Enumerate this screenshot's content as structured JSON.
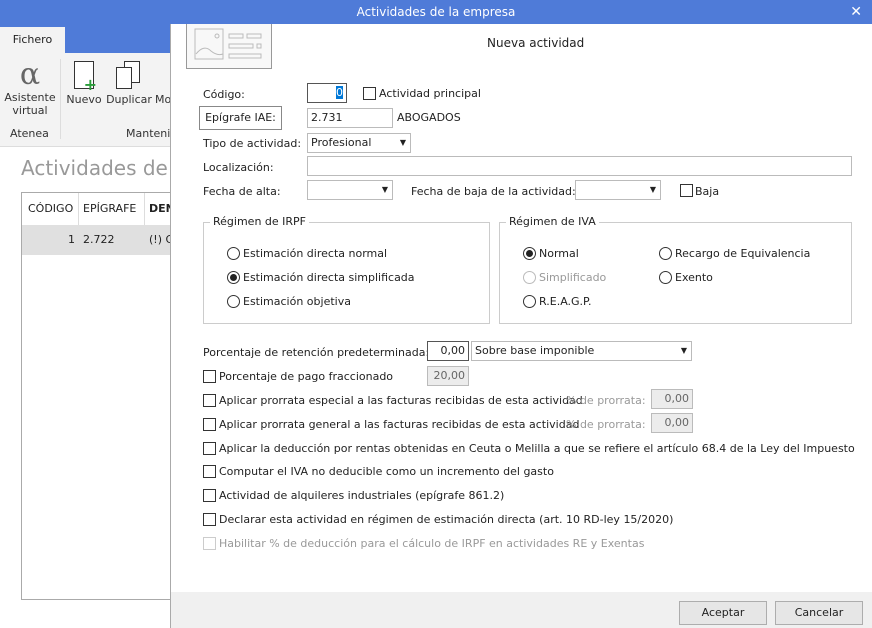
{
  "window": {
    "title": "Actividades de la empresa",
    "close": "✕"
  },
  "ribbon": {
    "tab": "Fichero",
    "assistant_line1": "Asistente",
    "assistant_line2": "virtual",
    "group_atenea": "Atenea",
    "nuevo": "Nuevo",
    "duplicar": "Duplicar",
    "mod": "Mo",
    "group_mant": "Manteni"
  },
  "list": {
    "title": "Actividades de la",
    "columns": [
      "CÓDIGO",
      "EPÍGRAFE",
      "DEN"
    ],
    "row": {
      "codigo": "1",
      "epigrafe": "2.722",
      "den": "(!) G"
    }
  },
  "dialog": {
    "title": "Nueva actividad",
    "codigo_label": "Código:",
    "codigo_value": "0",
    "principal_label": "Actividad principal",
    "epigrafe_button": "Epígrafe IAE:",
    "epigrafe_value": "2.731",
    "epigrafe_desc": "ABOGADOS",
    "tipo_label": "Tipo de actividad:",
    "tipo_value": "Profesional",
    "localizacion_label": "Localización:",
    "localizacion_value": "",
    "alta_label": "Fecha de alta:",
    "baja_fecha_label": "Fecha de baja de la actividad:",
    "baja_label": "Baja",
    "irpf": {
      "title": "Régimen de IRPF",
      "options": [
        "Estimación directa normal",
        "Estimación directa simplificada",
        "Estimación objetiva"
      ],
      "selected": 1
    },
    "iva": {
      "title": "Régimen de IVA",
      "options": [
        "Normal",
        "Simplificado",
        "R.E.A.G.P.",
        "Recargo de Equivalencia",
        "Exento"
      ],
      "selected": 0
    },
    "retencion_label": "Porcentaje de retención predeterminada:",
    "retencion_value": "0,00",
    "retencion_base": "Sobre base imponible",
    "fraccionado_label": "Porcentaje de pago fraccionado",
    "fraccionado_value": "20,00",
    "prorrata_especial_label": "Aplicar prorrata especial a las facturas recibidas de esta actividad",
    "prorrata_general_label": "Aplicar prorrata general a las facturas recibidas de esta actividad",
    "prorrata_pct_label": "% de prorrata:",
    "prorrata_especial_value": "0,00",
    "prorrata_general_value": "0,00",
    "ceuta_label": "Aplicar la deducción por rentas obtenidas en Ceuta o Melilla a que se refiere el artículo 68.4 de la Ley del Impuesto",
    "iva_no_deducible_label": "Computar el IVA no deducible como un incremento del gasto",
    "alquileres_label": "Actividad de alquileres industriales (epígrafe 861.2)",
    "estimacion_directa_label": "Declarar esta actividad en régimen de estimación directa (art. 10 RD-ley 15/2020)",
    "habilitar_label": "Habilitar % de deducción para el cálculo de IRPF en actividades RE y Exentas",
    "aceptar": "Aceptar",
    "cancelar": "Cancelar"
  },
  "colors": {
    "titlebar": "#4f7bd8",
    "selection": "#0078d7"
  }
}
